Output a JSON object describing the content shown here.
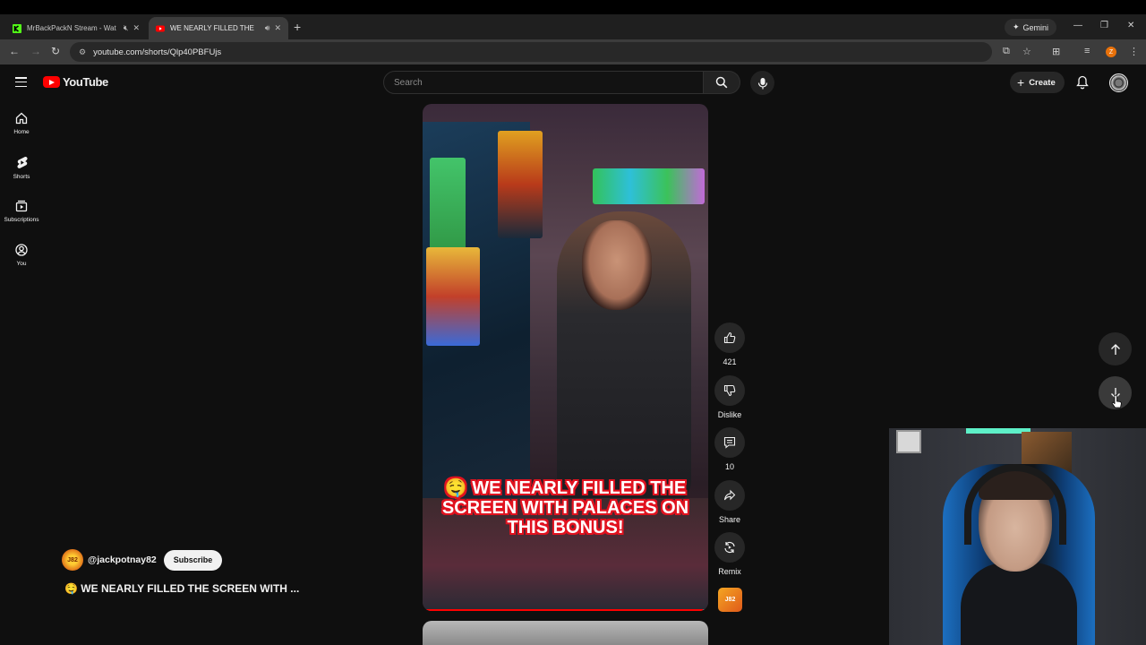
{
  "browser": {
    "tabs": [
      {
        "title": "MrBackPackN Stream - Wat",
        "state": "inactive",
        "favicon_color": "#53fc18"
      },
      {
        "title": "WE NEARLY FILLED THE",
        "state": "active",
        "favicon_color": "#ff0000"
      }
    ],
    "gemini_label": "Gemini",
    "url": "youtube.com/shorts/Qlp40PBFUjs",
    "profile_initial": "Z"
  },
  "youtube": {
    "logo_text": "YouTube",
    "search_placeholder": "Search",
    "create_label": "Create",
    "nav": [
      {
        "label": "Home",
        "icon": "home-icon"
      },
      {
        "label": "Shorts",
        "icon": "shorts-icon"
      },
      {
        "label": "Subscriptions",
        "icon": "subscriptions-icon"
      },
      {
        "label": "You",
        "icon": "you-icon"
      }
    ]
  },
  "short": {
    "caption": "WE NEARLY FILLED THE SCREEN WITH PALACES ON THIS BONUS!",
    "caption_emoji": "🤤",
    "progress": 0.98,
    "channel_handle": "@jackpotnay82",
    "channel_avatar_text": "J82",
    "subscribe_label": "Subscribe",
    "title": "🤤 WE NEARLY FILLED THE SCREEN WITH ...",
    "actions": {
      "like_count": "421",
      "dislike_label": "Dislike",
      "comment_count": "10",
      "share_label": "Share",
      "remix_label": "Remix"
    }
  },
  "colors": {
    "brand_red": "#ff0000",
    "caption_outline": "#e1121f",
    "background": "#0f0f0f"
  }
}
